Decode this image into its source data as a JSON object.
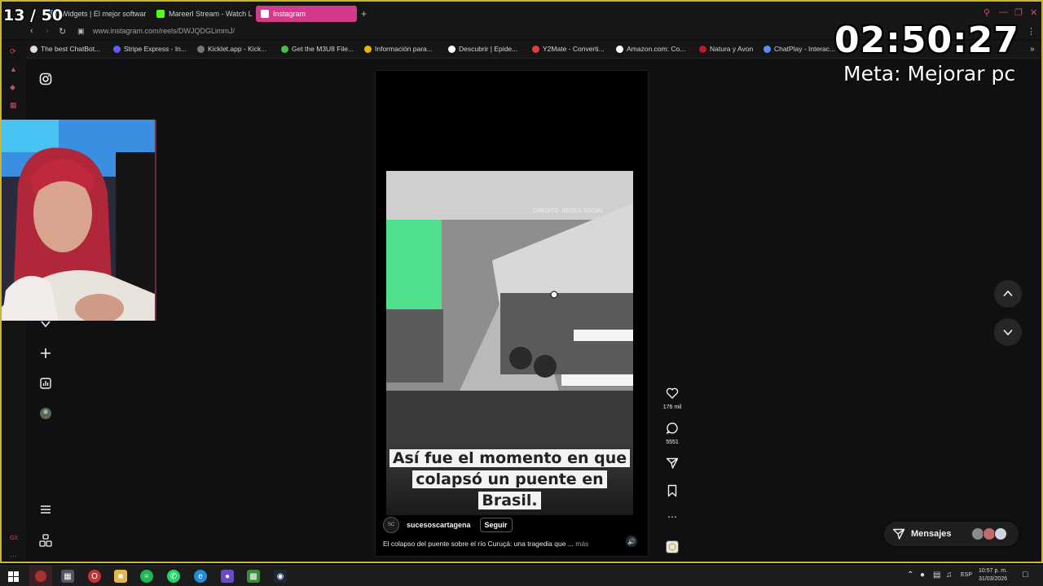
{
  "browser": {
    "tabs": [
      {
        "label": "Widgets | El mejor softwar",
        "icon": "widgets-tab-icon",
        "color": "#3aa0ff"
      },
      {
        "label": "Mareerl Stream - Watch L",
        "icon": "kick-tab-icon",
        "color": "#53fc18"
      },
      {
        "label": "Instagram",
        "icon": "instagram-tab-icon",
        "color": "#d33a8a",
        "active": true
      }
    ],
    "url": "www.instagram.com/reels/DWJQDGLimmJ/",
    "bookmarks": [
      {
        "label": "The best ChatBot...",
        "color": "#dddddd"
      },
      {
        "label": "Stripe Express - In...",
        "color": "#635bff"
      },
      {
        "label": "Kicklet.app - Kick...",
        "color": "#777777"
      },
      {
        "label": "Get the M3U8 File...",
        "color": "#46c046"
      },
      {
        "label": "Información para...",
        "color": "#f0b400"
      },
      {
        "label": "Descubrir | Epide...",
        "color": "#ffffff"
      },
      {
        "label": "Y2Mate - Converti...",
        "color": "#e63c3c"
      },
      {
        "label": "Amazon.com: Co...",
        "color": "#ffffff"
      },
      {
        "label": "Natura y Avon",
        "color": "#c4162a"
      },
      {
        "label": "ChatPlay - Interac...",
        "color": "#5b8cff"
      }
    ]
  },
  "overlay": {
    "counter": "13 / 50",
    "timer": "02:50:27",
    "goal": "Meta: Mejorar pc"
  },
  "reel": {
    "video_caption": "Así fue el momento en que colapsó un puente en Brasil.",
    "watermark": "CRÉDITO: REDES SOCIAL",
    "author": "sucesoscartagena",
    "follow_label": "Seguir",
    "description": "El colapso del puente sobre el río Curuçá: una tragedia que ...",
    "more_label": "más",
    "likes": "176 mil",
    "comments": "5551"
  },
  "messages": {
    "label": "Mensajes"
  },
  "taskbar": {
    "language": "ESP",
    "time": "10:57 p. m.",
    "date": "31/03/2026"
  },
  "colors": {
    "frame": "#c9b33a",
    "accent": "#d33a8a",
    "background": "#0f1012"
  }
}
